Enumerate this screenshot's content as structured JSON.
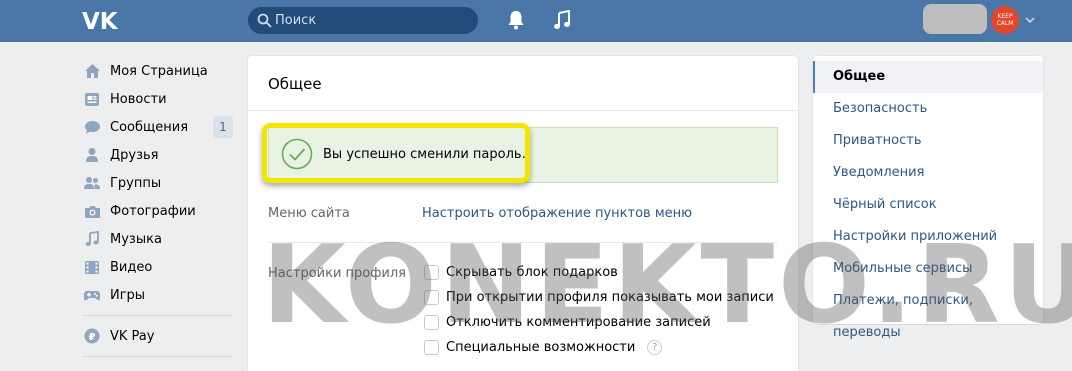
{
  "header": {
    "search_placeholder": "Поиск",
    "avatar_text": "KEEP CALM"
  },
  "sidebar": {
    "items": [
      {
        "label": "Моя Страница",
        "icon": "home-icon"
      },
      {
        "label": "Новости",
        "icon": "news-icon"
      },
      {
        "label": "Сообщения",
        "icon": "messages-icon",
        "badge": "1"
      },
      {
        "label": "Друзья",
        "icon": "friends-icon"
      },
      {
        "label": "Группы",
        "icon": "groups-icon"
      },
      {
        "label": "Фотографии",
        "icon": "camera-icon"
      },
      {
        "label": "Музыка",
        "icon": "music-icon"
      },
      {
        "label": "Видео",
        "icon": "video-icon"
      },
      {
        "label": "Игры",
        "icon": "gamepad-icon"
      },
      {
        "label": "VK Pay",
        "icon": "vkpay-icon"
      }
    ]
  },
  "main": {
    "title": "Общее",
    "success_message": "Вы успешно сменили пароль.",
    "menu_row": {
      "label": "Меню сайта",
      "link": "Настроить отображение пунктов меню"
    },
    "profile_row": {
      "label": "Настройки профиля",
      "options": [
        {
          "label": "Скрывать блок подарков",
          "checked": false
        },
        {
          "label": "При открытии профиля показывать мои записи",
          "checked": false
        },
        {
          "label": "Отключить комментирование записей",
          "checked": false
        },
        {
          "label": "Специальные возможности",
          "checked": false,
          "help": "?"
        }
      ]
    }
  },
  "settings_menu": {
    "items": [
      {
        "label": "Общее",
        "active": true
      },
      {
        "label": "Безопасность",
        "active": false
      },
      {
        "label": "Приватность",
        "active": false
      },
      {
        "label": "Уведомления",
        "active": false
      },
      {
        "label": "Чёрный список",
        "active": false
      },
      {
        "label": "Настройки приложений",
        "active": false
      },
      {
        "label": "Мобильные сервисы",
        "active": false
      },
      {
        "label": "Платежи, подписки, переводы",
        "active": false
      }
    ]
  },
  "watermark": "KONEKTO.RU",
  "colors": {
    "header_bg": "#4a76a8",
    "link": "#2a5885",
    "success_bg": "#e8f3e4",
    "highlight": "#f2e600"
  }
}
